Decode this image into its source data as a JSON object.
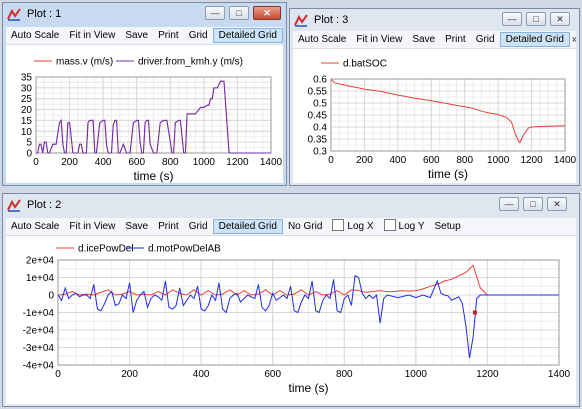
{
  "windows": {
    "plot1": {
      "title": "Plot : 1",
      "toolbar": [
        "Auto Scale",
        "Fit in View",
        "Save",
        "Print",
        "Grid",
        "Detailed Grid"
      ],
      "overflow": "»"
    },
    "plot3": {
      "title": "Plot : 3",
      "toolbar": [
        "Auto Scale",
        "Fit in View",
        "Save",
        "Print",
        "Grid",
        "Detailed Grid"
      ],
      "overflow": "»"
    },
    "plot2": {
      "title": "Plot : 2",
      "toolbar": [
        "Auto Scale",
        "Fit in View",
        "Save",
        "Print",
        "Grid",
        "Detailed Grid",
        "No Grid"
      ],
      "checkboxes": [
        "Log X",
        "Log Y"
      ],
      "setup": "Setup"
    }
  },
  "window_buttons": {
    "minimize": "—",
    "maximize": "□",
    "close": "✕"
  },
  "colors": {
    "red": "#e8403a",
    "blue": "#1f2ee0",
    "purple": "#6a2fb0",
    "grid": "#d8d8d8",
    "active_title": "#c8daf0",
    "inactive_title": "#dfe6ef",
    "selected_button": "#cde3f7"
  },
  "chart_data": [
    {
      "id": "plot1",
      "type": "line",
      "xlabel": "time (s)",
      "ylabel": "",
      "xlim": [
        0,
        1400
      ],
      "ylim": [
        0,
        35
      ],
      "xticks": [
        0,
        200,
        400,
        600,
        800,
        1000,
        1200,
        1400
      ],
      "yticks": [
        0,
        5,
        10,
        15,
        20,
        25,
        30,
        35
      ],
      "grid": true,
      "legend": "top",
      "series": [
        {
          "name": "mass.v (m/s)",
          "color": "#e8403a",
          "x": [
            0,
            10,
            20,
            30,
            40,
            50,
            60,
            70,
            80,
            100,
            120,
            140,
            150,
            160,
            170,
            180,
            190,
            200,
            220,
            250,
            260,
            270,
            280,
            300,
            310,
            320,
            340,
            350,
            360,
            380,
            400,
            410,
            420,
            430,
            450,
            460,
            470,
            480,
            490,
            500,
            520,
            540,
            560,
            580,
            600,
            610,
            620,
            630,
            640,
            650,
            660,
            670,
            680,
            700,
            720,
            740,
            760,
            780,
            800,
            810,
            820,
            830,
            850,
            860,
            880,
            890,
            900,
            920,
            950,
            980,
            1000,
            1020,
            1030,
            1040,
            1050,
            1060,
            1080,
            1100,
            1120,
            1130,
            1150,
            1160,
            1180,
            1400
          ],
          "y": [
            0,
            0,
            4,
            4,
            0,
            5,
            5,
            0,
            0,
            4,
            4,
            14,
            15,
            4,
            0,
            0,
            14,
            14,
            0,
            0,
            4,
            4,
            0,
            0,
            14,
            15,
            15,
            0,
            0,
            14,
            15,
            15,
            4,
            0,
            0,
            13,
            15,
            15,
            0,
            0,
            4,
            0,
            0,
            14,
            15,
            15,
            5,
            0,
            0,
            14,
            15,
            15,
            4,
            0,
            0,
            14,
            15,
            15,
            5,
            0,
            0,
            14,
            15,
            15,
            0,
            0,
            18,
            18,
            18,
            21,
            21,
            22,
            22,
            25,
            25,
            30,
            30,
            33,
            33,
            22,
            0,
            0,
            0,
            0
          ]
        },
        {
          "name": "driver.from_kmh.y (m/s)",
          "color": "#6a2fb0",
          "x": [
            0,
            10,
            20,
            30,
            40,
            50,
            60,
            70,
            80,
            100,
            120,
            140,
            150,
            160,
            170,
            180,
            190,
            200,
            220,
            250,
            260,
            270,
            280,
            300,
            310,
            320,
            340,
            350,
            360,
            380,
            400,
            410,
            420,
            430,
            450,
            460,
            470,
            480,
            490,
            500,
            520,
            540,
            560,
            580,
            600,
            610,
            620,
            630,
            640,
            650,
            660,
            670,
            680,
            700,
            720,
            740,
            760,
            780,
            800,
            810,
            820,
            830,
            850,
            860,
            880,
            890,
            900,
            920,
            950,
            980,
            1000,
            1020,
            1030,
            1040,
            1050,
            1060,
            1080,
            1100,
            1120,
            1130,
            1150,
            1160,
            1180,
            1400
          ],
          "y": [
            0,
            0,
            4,
            4,
            0,
            5,
            5,
            0,
            0,
            4,
            4,
            14,
            15,
            4,
            0,
            0,
            14,
            14,
            0,
            0,
            4,
            4,
            0,
            0,
            14,
            15,
            15,
            0,
            0,
            14,
            15,
            15,
            4,
            0,
            0,
            13,
            15,
            15,
            0,
            0,
            4,
            0,
            0,
            14,
            15,
            15,
            5,
            0,
            0,
            14,
            15,
            15,
            4,
            0,
            0,
            14,
            15,
            15,
            5,
            0,
            0,
            14,
            15,
            15,
            0,
            0,
            18,
            18,
            18,
            21,
            21,
            22,
            22,
            25,
            25,
            30,
            30,
            33,
            33,
            22,
            0,
            0,
            0,
            0
          ]
        }
      ]
    },
    {
      "id": "plot3",
      "type": "line",
      "xlabel": "time (s)",
      "ylabel": "",
      "xlim": [
        0,
        1400
      ],
      "ylim": [
        0.3,
        0.6
      ],
      "xticks": [
        0,
        200,
        400,
        600,
        800,
        1000,
        1200,
        1400
      ],
      "yticks": [
        0.3,
        0.35,
        0.4,
        0.45,
        0.5,
        0.55,
        0.6
      ],
      "grid": true,
      "legend": "top",
      "series": [
        {
          "name": "d.batSOC",
          "color": "#e8403a",
          "x": [
            0,
            20,
            60,
            100,
            150,
            200,
            250,
            300,
            350,
            400,
            450,
            500,
            550,
            600,
            650,
            700,
            750,
            800,
            850,
            900,
            950,
            1000,
            1050,
            1080,
            1100,
            1120,
            1130,
            1150,
            1180,
            1200,
            1250,
            1300,
            1350,
            1400
          ],
          "y": [
            0.6,
            0.585,
            0.578,
            0.572,
            0.565,
            0.558,
            0.553,
            0.548,
            0.541,
            0.533,
            0.527,
            0.52,
            0.515,
            0.509,
            0.503,
            0.497,
            0.49,
            0.484,
            0.478,
            0.466,
            0.458,
            0.452,
            0.44,
            0.42,
            0.375,
            0.345,
            0.335,
            0.365,
            0.395,
            0.4,
            0.402,
            0.403,
            0.404,
            0.405
          ]
        }
      ]
    },
    {
      "id": "plot2",
      "type": "line",
      "xlabel": "time (s)",
      "ylabel": "",
      "xlim": [
        0,
        1400
      ],
      "ylim": [
        -40000,
        20000
      ],
      "xticks": [
        0,
        200,
        400,
        600,
        800,
        1000,
        1200,
        1400
      ],
      "yticks": [
        -40000,
        -30000,
        -20000,
        -10000,
        0,
        10000,
        20000
      ],
      "ytick_labels": [
        "-4e+04",
        "-3e+04",
        "-2e+04",
        "-1e+04",
        "0",
        "1e+04",
        "2e+04"
      ],
      "grid": true,
      "legend": "top",
      "series": [
        {
          "name": "d.icePowDel",
          "color": "#e8403a",
          "x": [
            0,
            20,
            40,
            60,
            80,
            100,
            120,
            140,
            160,
            180,
            200,
            220,
            240,
            260,
            280,
            300,
            320,
            340,
            360,
            380,
            400,
            420,
            440,
            460,
            480,
            500,
            520,
            540,
            560,
            580,
            600,
            620,
            640,
            660,
            680,
            700,
            720,
            740,
            760,
            780,
            800,
            820,
            840,
            860,
            880,
            900,
            920,
            940,
            960,
            980,
            1000,
            1020,
            1040,
            1060,
            1080,
            1100,
            1120,
            1140,
            1160,
            1180,
            1200,
            1400
          ],
          "y": [
            0,
            500,
            2000,
            0,
            500,
            0,
            1500,
            3000,
            0,
            500,
            2000,
            0,
            500,
            0,
            2000,
            0,
            3000,
            1000,
            0,
            3000,
            0,
            2500,
            0,
            500,
            3000,
            0,
            2500,
            0,
            500,
            3000,
            0,
            2500,
            0,
            500,
            3000,
            0,
            2000,
            0,
            500,
            2500,
            0,
            3000,
            2500,
            1500,
            2000,
            2500,
            1800,
            2000,
            2500,
            2200,
            2500,
            3500,
            5000,
            6000,
            8000,
            9000,
            11000,
            13000,
            17000,
            4000,
            0,
            0
          ]
        },
        {
          "name": "d.motPowDelAB",
          "color": "#1f2ee0",
          "x": [
            0,
            10,
            20,
            30,
            40,
            50,
            60,
            70,
            80,
            90,
            100,
            110,
            120,
            130,
            140,
            150,
            160,
            170,
            180,
            190,
            200,
            210,
            220,
            230,
            240,
            250,
            260,
            270,
            280,
            290,
            300,
            310,
            320,
            330,
            340,
            350,
            360,
            370,
            380,
            390,
            400,
            410,
            420,
            430,
            440,
            450,
            460,
            470,
            480,
            490,
            500,
            510,
            520,
            530,
            540,
            550,
            560,
            570,
            580,
            590,
            600,
            610,
            620,
            630,
            640,
            650,
            660,
            670,
            680,
            690,
            700,
            710,
            720,
            730,
            740,
            750,
            760,
            770,
            780,
            790,
            800,
            810,
            820,
            830,
            840,
            850,
            860,
            870,
            880,
            890,
            900,
            910,
            920,
            950,
            980,
            1000,
            1020,
            1040,
            1060,
            1070,
            1080,
            1090,
            1100,
            1110,
            1120,
            1130,
            1140,
            1150,
            1160,
            1170,
            1180,
            1200,
            1400
          ],
          "y": [
            0,
            -3000,
            4000,
            -2000,
            0,
            1000,
            -1000,
            0,
            0,
            -2000,
            6000,
            -8000,
            -9000,
            -5000,
            0,
            2000,
            -6000,
            -5000,
            0,
            -2000,
            7000,
            -10000,
            -3000,
            0,
            2000,
            -7000,
            -2000,
            0,
            -1000,
            -3000,
            8000,
            -7000,
            -8000,
            -6000,
            4000,
            -6000,
            -3000,
            0,
            -2000,
            5000,
            -8000,
            -9000,
            -6000,
            0,
            -3000,
            7000,
            -8000,
            -10000,
            -2000,
            0,
            1000,
            -4000,
            -2000,
            0,
            -1000,
            -2000,
            6000,
            -7000,
            -9000,
            -6000,
            1000,
            -3000,
            -1500,
            0,
            -2000,
            5000,
            -9000,
            -10000,
            -4000,
            0,
            -2000,
            8000,
            -9000,
            -10000,
            -3000,
            0,
            -2000,
            9000,
            -9000,
            -10000,
            -2000,
            0,
            -6000,
            11000,
            10000,
            1000,
            -2000,
            0,
            -2000,
            0,
            -16000,
            -2000,
            0,
            -1500,
            0,
            -1500,
            0,
            -1500,
            8000,
            1000,
            0,
            -500,
            -3000,
            -2000,
            -1000,
            -5000,
            -18000,
            -36000,
            -24000,
            -2000,
            0,
            0,
            0
          ]
        }
      ],
      "marker": {
        "x": 1165,
        "y": -10000,
        "color": "#c81e1e"
      }
    }
  ]
}
